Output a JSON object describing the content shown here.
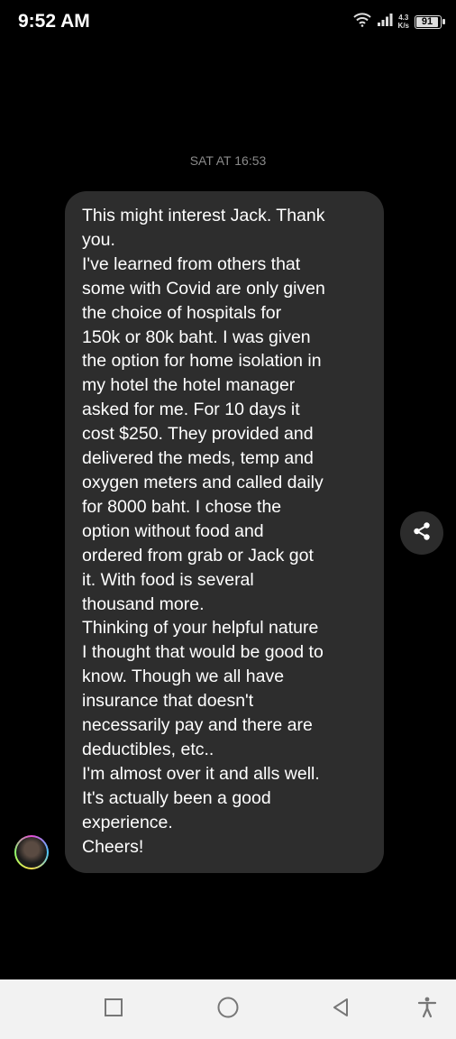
{
  "status_bar": {
    "time": "9:52 AM",
    "net_speed_value": "4.3",
    "net_speed_unit": "K/s",
    "battery": "91"
  },
  "conversation": {
    "timestamp": "SAT AT 16:53",
    "message_lines": [
      "This might interest Jack. Thank",
      "you.",
      "I've learned from others that",
      "some with Covid are only given",
      "the choice of hospitals for",
      "150k or 80k baht. I was given",
      "the option for home isolation in",
      "my hotel the hotel manager",
      "asked for me. For 10 days it",
      "cost $250. They provided and",
      "delivered the meds, temp and",
      "oxygen meters and called daily",
      "for 8000 baht. I chose the",
      "option without food and",
      "ordered from grab or Jack got",
      "it. With food is several",
      "thousand more.",
      "Thinking of your helpful nature",
      "I thought that would be good to",
      "know. Though we all have",
      "insurance that doesn't",
      "necessarily pay and there are",
      "deductibles, etc..",
      "I'm almost over it and alls well.",
      "It's actually been a good",
      "experience.",
      "Cheers!"
    ]
  },
  "icons": {
    "wifi": "wifi-icon",
    "signal": "signal-icon",
    "battery": "battery-icon",
    "share": "share-icon",
    "avatar": "avatar",
    "nav_recents": "square-icon",
    "nav_home": "circle-icon",
    "nav_back": "back-triangle-icon",
    "nav_accessibility": "accessibility-icon"
  },
  "colors": {
    "background": "#000000",
    "bubble": "#2d2d2d",
    "timestamp": "#8a8a8a",
    "nav_bar": "#f2f2f2"
  }
}
